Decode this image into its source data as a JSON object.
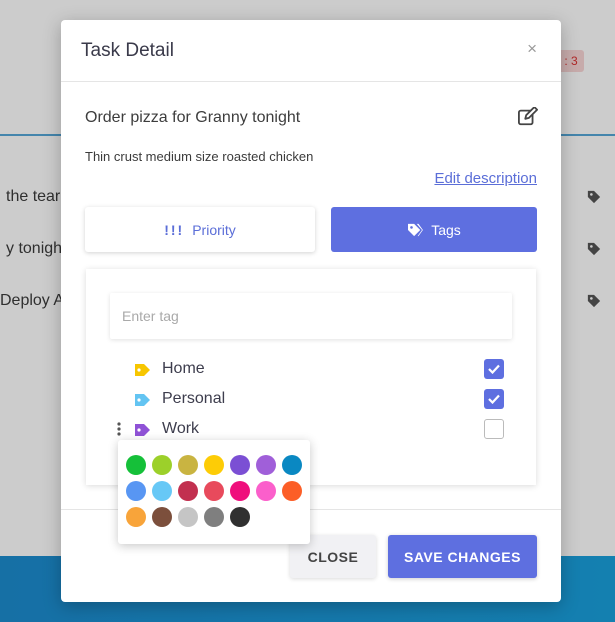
{
  "background": {
    "rows": [
      "the tear",
      "y tonigh",
      "Deploy A"
    ],
    "badge": ": 3"
  },
  "modal": {
    "title": "Task Detail",
    "close_icon": "×",
    "task_title": "Order pizza for Granny tonight",
    "task_description": "Thin crust medium size roasted chicken",
    "edit_description_label": "Edit description",
    "priority_button": {
      "icon": "!!!",
      "label": "Priority"
    },
    "tags_button": {
      "label": "Tags"
    },
    "tag_input_placeholder": "Enter tag",
    "tags": [
      {
        "label": "Home",
        "color": "#f7c600",
        "checked": true
      },
      {
        "label": "Personal",
        "color": "#63c4f2",
        "checked": true
      },
      {
        "label": "Work",
        "color": "#8f52d6",
        "checked": false
      }
    ],
    "palette_colors": [
      "#15c039",
      "#9cd02a",
      "#c9b441",
      "#fdcc06",
      "#7b4fd4",
      "#a05fd9",
      "#0a88c2",
      "#5896f3",
      "#67c8f6",
      "#c2304f",
      "#e84a5c",
      "#ef0f7c",
      "#fb5fcb",
      "#fc5e27",
      "#f8a43a",
      "#7c4f3c",
      "#c5c5c5",
      "#7f7f7f",
      "#303030"
    ],
    "close_button": "CLOSE",
    "save_button": "SAVE CHANGES"
  }
}
